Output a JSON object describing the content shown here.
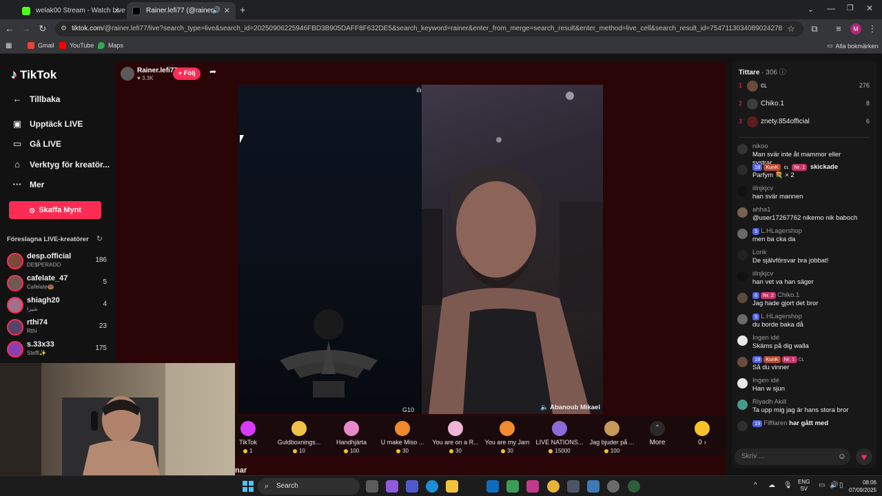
{
  "browser": {
    "tabs": [
      {
        "title": "welak00 Stream - Watch Live o",
        "active": false
      },
      {
        "title": "Rainer.lefi77 (@rainer.lefi77",
        "active": true
      }
    ],
    "url_host": "tiktok.com",
    "url_path": "/@rainer.lefi77/live?search_type=live&search_id=20250906225946FBD3B905DAFF8F632DE5&search_keyword=rainer&enter_from_merge=search_result&enter_method=live_cell&search_result_id=7547113034089024278",
    "bookmarks": [
      "Gmail",
      "YouTube",
      "Maps"
    ],
    "all_bookmarks": "Alla bokmärken",
    "profile_initial": "M"
  },
  "sidebar": {
    "logo": "TikTok",
    "back": "Tillbaka",
    "nav": [
      {
        "label": "Upptäck LIVE",
        "icon": "calendar-icon"
      },
      {
        "label": "Gå LIVE",
        "icon": "video-camera-icon"
      },
      {
        "label": "Verktyg för kreatör...",
        "icon": "home-tools-icon"
      },
      {
        "label": "Mer",
        "icon": "more-icon"
      }
    ],
    "coins_button": "Skaffa Mynt",
    "suggested_header": "Föreslagna LIVE-kreatörer",
    "creators": [
      {
        "name": "desp.official",
        "sub": "DE$PERADO",
        "count": "186"
      },
      {
        "name": "cafelate_47",
        "sub": "Cafelate🍩",
        "count": "5"
      },
      {
        "name": "shiagh20",
        "sub": "شیرا",
        "count": "4"
      },
      {
        "name": "rthi74",
        "sub": "Rthi",
        "count": "23"
      },
      {
        "name": "s.33x33",
        "sub": "Steffi✨",
        "count": "175"
      }
    ]
  },
  "host": {
    "name": "Rainer.lefi77",
    "likes": "3.3K",
    "follow": "+ Följ"
  },
  "stage": {
    "guest_left_label": "G10",
    "guest_right_label": "Abanoub Mikael"
  },
  "gifts": [
    {
      "name": "TikTok",
      "price": "1",
      "color": "#d63cff"
    },
    {
      "name": "Guldboxnings...",
      "price": "10",
      "color": "#f2c247"
    },
    {
      "name": "Handhjärta",
      "price": "100",
      "color": "#e68acb"
    },
    {
      "name": "U make Miso ...",
      "price": "30",
      "color": "#f08a2a"
    },
    {
      "name": "You are on a R...",
      "price": "30",
      "color": "#f0b4d6"
    },
    {
      "name": "You are my Jam",
      "price": "30",
      "color": "#f28a2e"
    },
    {
      "name": "LIVE NATIONS...",
      "price": "15000",
      "color": "#8b6ad9"
    },
    {
      "name": "Jag bjuder på ...",
      "price": "100",
      "color": "#c59a5a"
    }
  ],
  "gift_more": "More",
  "coin_balance": "0",
  "chat": {
    "viewers_label": "Tittare",
    "viewers_count": "· 306",
    "top": [
      {
        "rank": "1",
        "name": "ᴄʟ",
        "count": "276"
      },
      {
        "rank": "2",
        "name": "Chiko.1",
        "count": "8"
      },
      {
        "rank": "3",
        "name": "znety.854official",
        "count": "6"
      }
    ],
    "messages": [
      {
        "user": "nikoo",
        "text": "Man svär inte åt mammor eller",
        "text2": "systrar"
      },
      {
        "user": "",
        "badges": [
          "18",
          "KunK",
          "ᴄʟ",
          "Nr. 1"
        ],
        "text": "skickade",
        "text2": "Parfym 💐 × 2"
      },
      {
        "user": "iilnjkjcv",
        "text": "han svär mannen"
      },
      {
        "user": "ahha1",
        "text": "@user17267762 nikemo nik baboch"
      },
      {
        "user": "L.HLagershop",
        "badge": "5",
        "text": "men ba cka da"
      },
      {
        "user": "Lorik",
        "text": "De självförsvar bra jobbat!"
      },
      {
        "user": "iilnjkjcv",
        "text": "han vet va han säger"
      },
      {
        "user": "Chiko.1",
        "badge": "6",
        "badge2": "Nr. 2",
        "text": "Jag hade gjort det bror"
      },
      {
        "user": "L.HLagershop",
        "badge": "5",
        "text": "du borde baka då"
      },
      {
        "user": "Ingen idé",
        "text": "Skäms på dig walla"
      },
      {
        "user": "ᴄʟ",
        "badges": [
          "18",
          "KunK",
          "Nr. 1"
        ],
        "text": "Så du vinner"
      },
      {
        "user": "Ingen idé",
        "text": "Han w sjun"
      },
      {
        "user": "Riyadh Akill",
        "text": "Ta upp mig jag är hans stora bror"
      },
      {
        "user": "Fifflaren",
        "badge": "19",
        "text": "har gått med"
      }
    ],
    "input_placeholder": "Skriv ..."
  },
  "webcam_caption": "nar",
  "taskbar": {
    "search": "Search",
    "lang": "ENG",
    "lang2": "SV",
    "time": "08:06",
    "date": "07/09/2025"
  }
}
